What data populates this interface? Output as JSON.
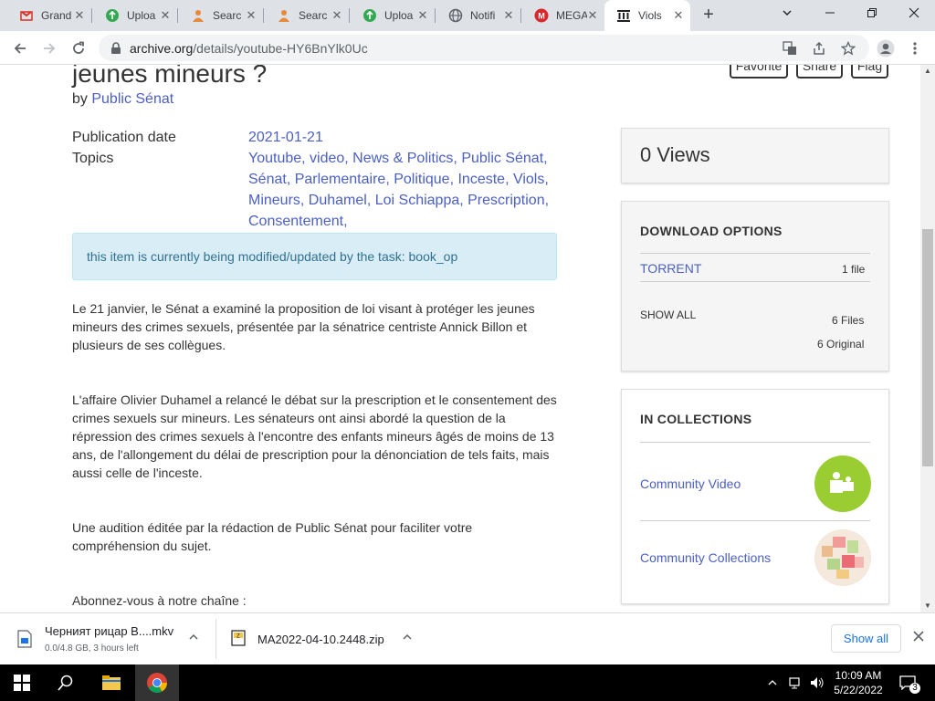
{
  "browser": {
    "tabs": [
      {
        "title": "Grand",
        "icon": "gmail-icon"
      },
      {
        "title": "Uploa",
        "icon": "upload-icon"
      },
      {
        "title": "Searc",
        "icon": "search-person-icon"
      },
      {
        "title": "Searc",
        "icon": "search-person-icon"
      },
      {
        "title": "Uploa",
        "icon": "upload-icon"
      },
      {
        "title": "Notifi",
        "icon": "globe-icon"
      },
      {
        "title": "MEGA",
        "icon": "mega-icon"
      },
      {
        "title": "Viols",
        "icon": "archive-icon"
      }
    ],
    "url_host": "archive.org",
    "url_path": "/details/youtube-HY6BnYlk0Uc"
  },
  "item": {
    "title": "jeunes mineurs ?",
    "by_prefix": "by",
    "creator": "Public Sénat",
    "buttons": {
      "favorite": "Favorite",
      "share": "Share",
      "flag": "Flag"
    },
    "publication_label": "Publication date",
    "publication_date": "2021-01-21",
    "topics_label": "Topics",
    "topics": [
      "Youtube",
      "video",
      "News & Politics",
      "Public Sénat",
      "Sénat",
      "Parlementaire",
      "Politique",
      "Inceste",
      "Viols",
      "Mineurs",
      "Duhamel",
      "Loi Schiappa",
      "Prescription",
      "Consentement"
    ],
    "notice": "this item is currently being modified/updated by the task: book_op",
    "description": [
      "Le 21 janvier, le Sénat a examiné la proposition de loi visant à protéger les jeunes mineurs des crimes sexuels, présentée par la sénatrice centriste Annick Billon et plusieurs de ses collègues.",
      "L'affaire Olivier Duhamel a relancé le débat sur la prescription et le consentement des crimes sexuels sur mineurs. Les sénateurs ont ainsi abordé la question de la répression des crimes sexuels à l'encontre des enfants mineurs âgés de moins de 13 ans, de l'allongement du délai de prescription pour la dénonciation de tels faits, mais aussi celle de l'inceste.",
      "Une audition éditée par la rédaction de Public Sénat pour faciliter votre compréhension du sujet.",
      "Abonnez-vous à notre chaîne :"
    ]
  },
  "sidebar": {
    "views": "0 Views",
    "download_heading": "DOWNLOAD OPTIONS",
    "torrent_label": "TORRENT",
    "torrent_count": "1 file",
    "show_all_label": "SHOW ALL",
    "files_count": "6 Files",
    "original_count": "6 Original",
    "collections_heading": "IN COLLECTIONS",
    "collections": [
      "Community Video",
      "Community Collections"
    ]
  },
  "downloads": [
    {
      "name": "Черният рицар B....mkv",
      "status": "0.0/4.8 GB, 3 hours left"
    },
    {
      "name": "MA2022-04-10.2448.zip",
      "status": ""
    }
  ],
  "downloads_show_all": "Show all",
  "taskbar": {
    "time": "10:09 AM",
    "date": "5/22/2022",
    "notifications": "3"
  },
  "colors": {
    "link": "#4b5fc4",
    "notice_bg": "#d9edf7",
    "notice_text": "#31708f",
    "collection_video": "#9acd32"
  }
}
